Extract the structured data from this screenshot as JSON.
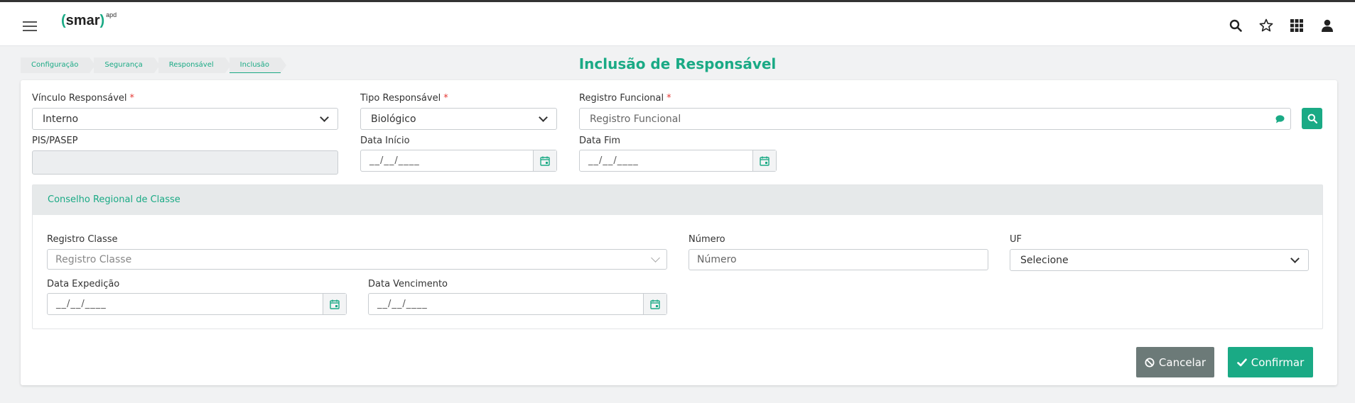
{
  "app": {
    "logo_text": "smar",
    "logo_sup": "apd"
  },
  "header_icons": [
    "search-icon",
    "star-icon",
    "apps-grid-icon",
    "user-icon"
  ],
  "breadcrumb": [
    "Configuração",
    "Segurança",
    "Responsável",
    "Inclusão"
  ],
  "page_title": "Inclusão de Responsável",
  "form": {
    "vinculo": {
      "label": "Vínculo Responsável",
      "required": "*",
      "value": "Interno"
    },
    "tipo": {
      "label": "Tipo Responsável",
      "required": "*",
      "value": "Biológico"
    },
    "registro_funcional": {
      "label": "Registro Funcional",
      "required": "*",
      "placeholder": "Registro Funcional"
    },
    "pis": {
      "label": "PIS/PASEP",
      "value": ""
    },
    "data_inicio": {
      "label": "Data Início",
      "mask": "__/__/____"
    },
    "data_fim": {
      "label": "Data Fim",
      "mask": "__/__/____"
    }
  },
  "conselho": {
    "title": "Conselho Regional de Classe",
    "registro_classe": {
      "label": "Registro Classe",
      "placeholder": "Registro Classe"
    },
    "numero": {
      "label": "Número",
      "placeholder": "Número"
    },
    "uf": {
      "label": "UF",
      "value": "Selecione"
    },
    "data_expedicao": {
      "label": "Data Expedição",
      "mask": "__/__/____"
    },
    "data_vencimento": {
      "label": "Data Vencimento",
      "mask": "__/__/____"
    }
  },
  "actions": {
    "cancel_label": "Cancelar",
    "confirm_label": "Confirmar"
  },
  "colors": {
    "accent": "#1aaa85",
    "cancel": "#6c7a78",
    "required": "#e53935"
  }
}
